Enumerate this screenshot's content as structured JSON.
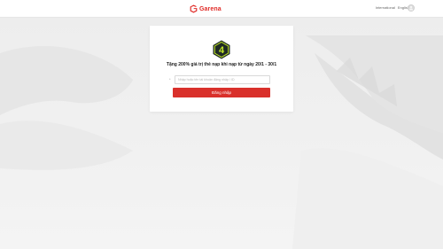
{
  "header": {
    "brand": "Garena",
    "region": "International",
    "language": "English",
    "logo_icon": "garena-logo-icon",
    "avatar_icon": "user-avatar-icon"
  },
  "card": {
    "badge_text": "4",
    "badge_icon": "hexagon-4-badge-icon",
    "promo_text": "Tặng 200% giá trị thẻ nạp khi nạp từ ngày 20/1 - 30/1",
    "required_marker": "*",
    "input": {
      "value": "",
      "placeholder": "Nhập hoặc tên tài khoản đăng nhập / ID"
    },
    "login_label": "Đăng nhập"
  },
  "colors": {
    "brand_red": "#e02b27",
    "button_red": "#d9302b",
    "badge_dark": "#1f2a24",
    "badge_green": "#c4e82a",
    "page_bg": "#ececec"
  }
}
